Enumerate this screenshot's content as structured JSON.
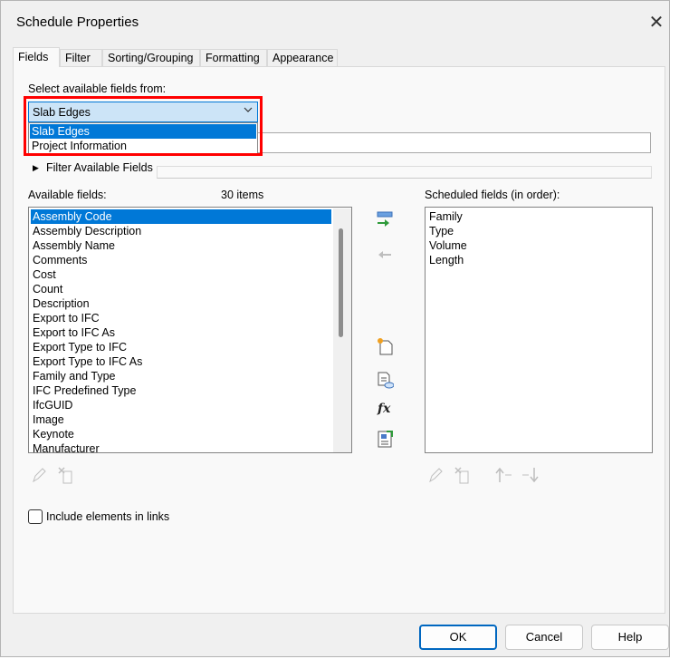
{
  "window": {
    "title": "Schedule Properties"
  },
  "tabs": [
    {
      "label": "Fields"
    },
    {
      "label": "Filter"
    },
    {
      "label": "Sorting/Grouping"
    },
    {
      "label": "Formatting"
    },
    {
      "label": "Appearance"
    }
  ],
  "source": {
    "label": "Select available fields from:",
    "selected": "Slab Edges",
    "options": [
      "Slab Edges",
      "Project Information"
    ]
  },
  "filter": {
    "label": "Filter Available Fields"
  },
  "available": {
    "label": "Available fields:",
    "count": "30 items",
    "items": [
      "Assembly Code",
      "Assembly Description",
      "Assembly Name",
      "Comments",
      "Cost",
      "Count",
      "Description",
      "Export to IFC",
      "Export to IFC As",
      "Export Type to IFC",
      "Export Type to IFC As",
      "Family and Type",
      "IFC Predefined Type",
      "IfcGUID",
      "Image",
      "Keynote",
      "Manufacturer"
    ]
  },
  "scheduled": {
    "label": "Scheduled fields (in order):",
    "items": [
      "Family",
      "Type",
      "Volume",
      "Length"
    ]
  },
  "include_links": {
    "label": "Include elements in links"
  },
  "buttons": {
    "ok": "OK",
    "cancel": "Cancel",
    "help": "Help"
  },
  "icons": {
    "add": "add-field-icon",
    "remove": "remove-field-icon",
    "new_param": "new-parameter-icon",
    "shared_param": "shared-parameter-icon",
    "formula": "formula-icon",
    "combine": "combine-parameters-icon",
    "edit": "edit-pencil-icon",
    "delete": "delete-parameter-icon",
    "move_up": "move-up-icon",
    "move_down": "move-down-icon"
  },
  "colors": {
    "selection": "#0078d7",
    "highlight_box": "#ff0000",
    "combo_bg": "#cce4f7"
  }
}
